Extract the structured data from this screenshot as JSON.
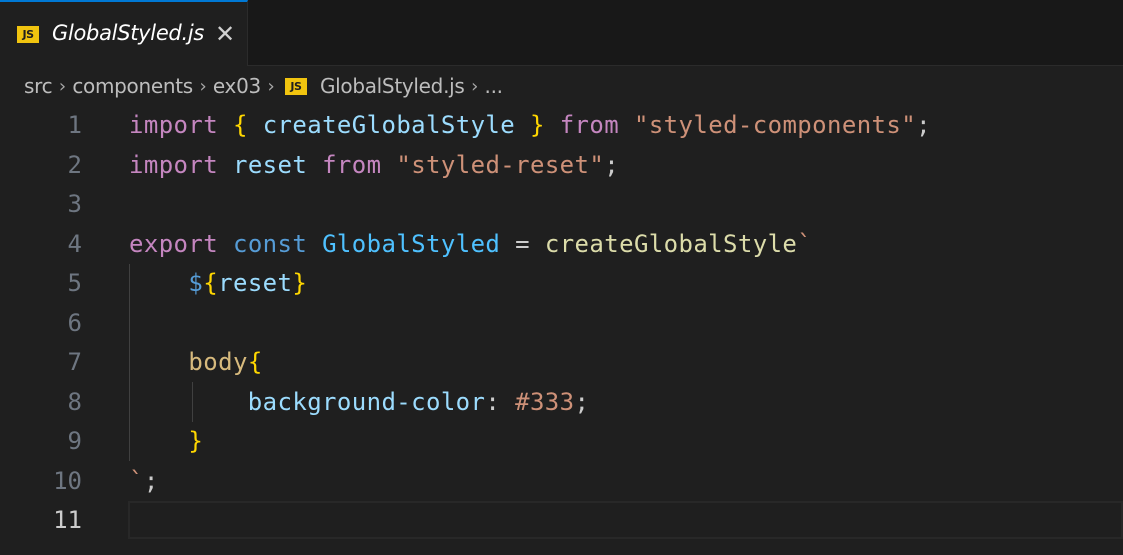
{
  "tab": {
    "icon_label": "JS",
    "title": "GlobalStyled.js",
    "close_glyph": "✕"
  },
  "breadcrumb": {
    "items": [
      "src",
      "components",
      "ex03",
      "GlobalStyled.js",
      "..."
    ],
    "separator": ">",
    "file_icon_label": "JS"
  },
  "editor": {
    "active_line": 11,
    "lines": [
      {
        "number": "1",
        "tokens": [
          {
            "t": "import",
            "c": "kw"
          },
          {
            "t": " ",
            "c": ""
          },
          {
            "t": "{",
            "c": "br1"
          },
          {
            "t": " ",
            "c": ""
          },
          {
            "t": "createGlobalStyle",
            "c": "var"
          },
          {
            "t": " ",
            "c": ""
          },
          {
            "t": "}",
            "c": "br1"
          },
          {
            "t": " ",
            "c": ""
          },
          {
            "t": "from",
            "c": "kw"
          },
          {
            "t": " ",
            "c": ""
          },
          {
            "t": "\"styled-components\"",
            "c": "str"
          },
          {
            "t": ";",
            "c": ""
          }
        ]
      },
      {
        "number": "2",
        "tokens": [
          {
            "t": "import",
            "c": "kw"
          },
          {
            "t": " ",
            "c": ""
          },
          {
            "t": "reset",
            "c": "var"
          },
          {
            "t": " ",
            "c": ""
          },
          {
            "t": "from",
            "c": "kw"
          },
          {
            "t": " ",
            "c": ""
          },
          {
            "t": "\"styled-reset\"",
            "c": "str"
          },
          {
            "t": ";",
            "c": ""
          }
        ]
      },
      {
        "number": "3",
        "tokens": []
      },
      {
        "number": "4",
        "tokens": [
          {
            "t": "export",
            "c": "kw"
          },
          {
            "t": " ",
            "c": ""
          },
          {
            "t": "const",
            "c": "kw2"
          },
          {
            "t": " ",
            "c": ""
          },
          {
            "t": "GlobalStyled",
            "c": "cst"
          },
          {
            "t": " = ",
            "c": ""
          },
          {
            "t": "createGlobalStyle",
            "c": "fn"
          },
          {
            "t": "`",
            "c": "str"
          }
        ]
      },
      {
        "number": "5",
        "tokens": [
          {
            "t": "    ",
            "c": ""
          },
          {
            "t": "$",
            "c": "tmpl"
          },
          {
            "t": "{",
            "c": "br1"
          },
          {
            "t": "reset",
            "c": "var"
          },
          {
            "t": "}",
            "c": "br1"
          }
        ]
      },
      {
        "number": "6",
        "tokens": []
      },
      {
        "number": "7",
        "tokens": [
          {
            "t": "    ",
            "c": ""
          },
          {
            "t": "body",
            "c": "sel"
          },
          {
            "t": "{",
            "c": "br1"
          }
        ]
      },
      {
        "number": "8",
        "tokens": [
          {
            "t": "        ",
            "c": ""
          },
          {
            "t": "background-color",
            "c": "prop"
          },
          {
            "t": ": ",
            "c": ""
          },
          {
            "t": "#333",
            "c": "str"
          },
          {
            "t": ";",
            "c": ""
          }
        ]
      },
      {
        "number": "9",
        "tokens": [
          {
            "t": "    ",
            "c": ""
          },
          {
            "t": "}",
            "c": "br1"
          }
        ]
      },
      {
        "number": "10",
        "tokens": [
          {
            "t": "`",
            "c": "str"
          },
          {
            "t": ";",
            "c": ""
          }
        ]
      },
      {
        "number": "11",
        "tokens": []
      }
    ]
  },
  "colors": {
    "tab_accent": "#0078d4",
    "js_icon": "#f1c40f",
    "background": "#1f1f1f"
  }
}
